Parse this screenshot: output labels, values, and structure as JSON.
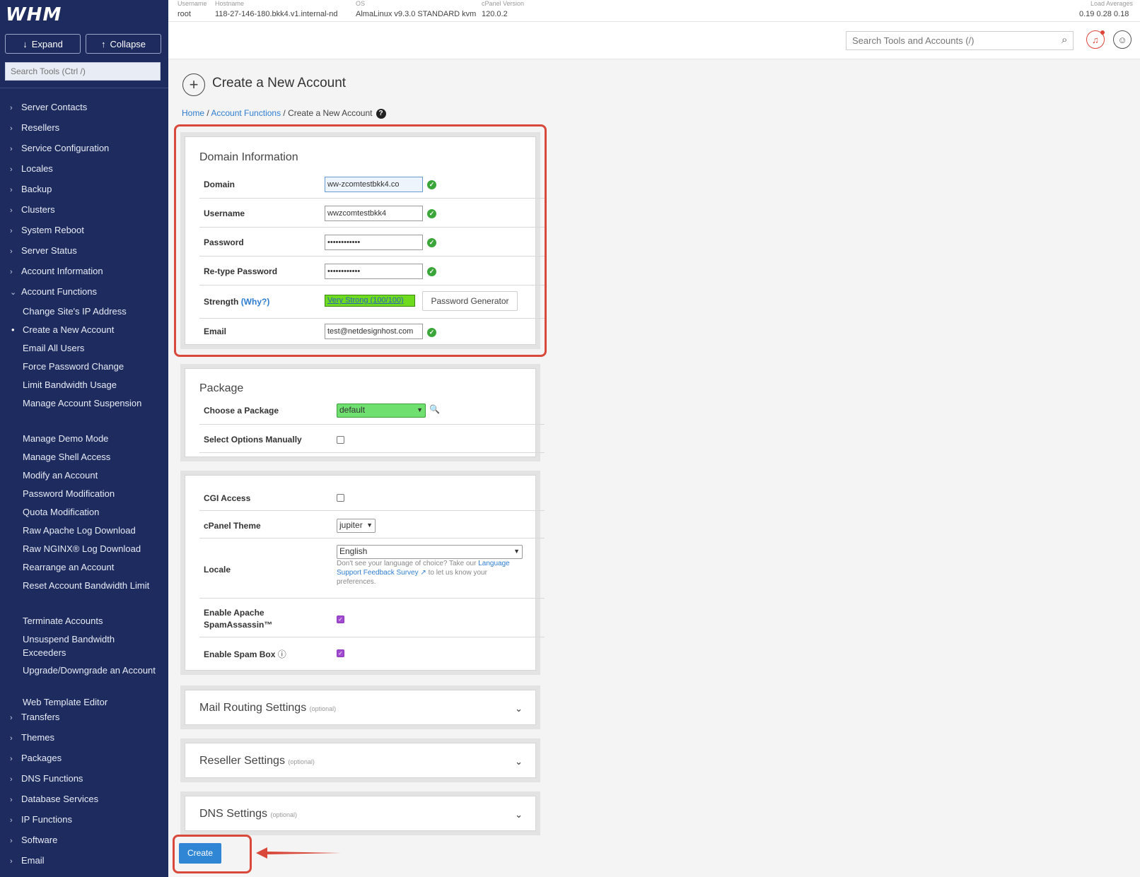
{
  "sidebar": {
    "logo": "WHM",
    "expand_label": "Expand",
    "collapse_label": "Collapse",
    "search_placeholder": "Search Tools (Ctrl /)",
    "top_items": [
      "Server Contacts",
      "Resellers",
      "Service Configuration",
      "Locales",
      "Backup",
      "Clusters",
      "System Reboot",
      "Server Status",
      "Account Information",
      "Account Functions"
    ],
    "sub_items": [
      "Change Site's IP Address",
      "Create a New Account",
      "Email All Users",
      "Force Password Change",
      "Limit Bandwidth Usage",
      "Manage Account Suspension",
      "Manage Demo Mode",
      "Manage Shell Access",
      "Modify an Account",
      "Password Modification",
      "Quota Modification",
      "Raw Apache Log Download",
      "Raw NGINX® Log Download",
      "Rearrange an Account",
      "Reset Account Bandwidth Limit",
      "Terminate Accounts",
      "Unsuspend Bandwidth Exceeders",
      "Upgrade/Downgrade an Account",
      "Web Template Editor"
    ],
    "bottom_items": [
      "Transfers",
      "Themes",
      "Packages",
      "DNS Functions",
      "Database Services",
      "IP Functions",
      "Software",
      "Email"
    ],
    "active_item": "Create a New Account"
  },
  "topbar": {
    "username_label": "Username",
    "username": "root",
    "hostname_label": "Hostname",
    "hostname": "118-27-146-180.bkk4.v1.internal-nd",
    "os_label": "OS",
    "os": "AlmaLinux v9.3.0 STANDARD kvm",
    "cpanel_label": "cPanel Version",
    "cpanel": "120.0.2",
    "load_label": "Load Averages",
    "load": "0.19  0.28  0.18"
  },
  "header": {
    "search_placeholder": "Search Tools and Accounts (/)"
  },
  "page": {
    "title": "Create a New Account",
    "breadcrumb": [
      "Home",
      "Account Functions",
      "Create a New Account"
    ]
  },
  "domain_info": {
    "title": "Domain Information",
    "domain_label": "Domain",
    "domain_value": "ww-zcomtestbkk4.co",
    "username_label": "Username",
    "username_value": "wwzcomtestbkk4",
    "password_label": "Password",
    "password_value": "••••••••••••",
    "retype_label": "Re-type Password",
    "retype_value": "••••••••••••",
    "strength_label": "Strength",
    "why_label": "(Why?)",
    "strength_value": "Very Strong (100/100)",
    "pwgen_label": "Password Generator",
    "email_label": "Email",
    "email_value": "test@netdesignhost.com"
  },
  "package": {
    "title": "Package",
    "choose_label": "Choose a Package",
    "choose_value": "default",
    "manual_label": "Select Options Manually"
  },
  "settings": {
    "cgi_label": "CGI Access",
    "theme_label": "cPanel Theme",
    "theme_value": "jupiter",
    "locale_label": "Locale",
    "locale_value": "English",
    "locale_note_a": "Don't see your language of choice? Take our",
    "locale_note_link": "Language Support Feedback Survey",
    "locale_note_b": "to let us know your preferences.",
    "spamassassin_label_1": "Enable Apache",
    "spamassassin_label_2": "SpamAssassin™",
    "spambox_label": "Enable Spam Box"
  },
  "collapsibles": [
    {
      "title": "Mail Routing Settings",
      "optional": "(optional)"
    },
    {
      "title": "Reseller Settings",
      "optional": "(optional)"
    },
    {
      "title": "DNS Settings",
      "optional": "(optional)"
    }
  ],
  "create_label": "Create",
  "colors": {
    "sidebar_bg": "#1d2b5e",
    "accent": "#2f86d4",
    "highlight": "#d9493b",
    "strength": "#6edb1f"
  }
}
